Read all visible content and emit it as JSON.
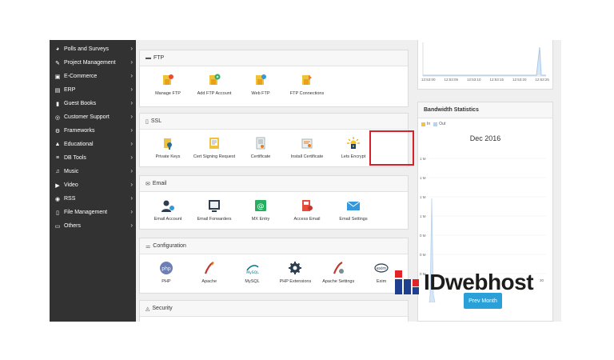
{
  "sidebar": {
    "items": [
      {
        "label": "Polls and Surveys",
        "icon": "pie-chart-icon",
        "glyph": "◕"
      },
      {
        "label": "Project Management",
        "icon": "edit-icon",
        "glyph": "✎"
      },
      {
        "label": "E-Commerce",
        "icon": "cart-icon",
        "glyph": "🛒"
      },
      {
        "label": "ERP",
        "icon": "chart-icon",
        "glyph": "▤"
      },
      {
        "label": "Guest Books",
        "icon": "book-icon",
        "glyph": "▮"
      },
      {
        "label": "Customer Support",
        "icon": "support-icon",
        "glyph": "◎"
      },
      {
        "label": "Frameworks",
        "icon": "cogs-icon",
        "glyph": "⚙"
      },
      {
        "label": "Educational",
        "icon": "graduation-cap-icon",
        "glyph": "🎓"
      },
      {
        "label": "DB Tools",
        "icon": "database-icon",
        "glyph": "≡"
      },
      {
        "label": "Music",
        "icon": "music-icon",
        "glyph": "♫"
      },
      {
        "label": "Video",
        "icon": "video-icon",
        "glyph": "▶"
      },
      {
        "label": "RSS",
        "icon": "rss-icon",
        "glyph": "◉"
      },
      {
        "label": "File Management",
        "icon": "file-icon",
        "glyph": "▯"
      },
      {
        "label": "Others",
        "icon": "folder-icon",
        "glyph": "▭"
      }
    ]
  },
  "panels": {
    "ftp": {
      "title": "FTP",
      "tools": [
        {
          "label": "Manage FTP",
          "icon": "manage-ftp-icon"
        },
        {
          "label": "Add FTP Account",
          "icon": "add-ftp-icon"
        },
        {
          "label": "Web FTP",
          "icon": "web-ftp-icon"
        },
        {
          "label": "FTP Connections",
          "icon": "ftp-connections-icon"
        }
      ]
    },
    "ssl": {
      "title": "SSL",
      "tools": [
        {
          "label": "Private Keys",
          "icon": "private-keys-icon"
        },
        {
          "label": "Cert Signing Request",
          "icon": "cert-signing-icon"
        },
        {
          "label": "Certificate",
          "icon": "certificate-icon"
        },
        {
          "label": "Install Certificate",
          "icon": "install-certificate-icon"
        },
        {
          "label": "Lets Encrypt",
          "icon": "lets-encrypt-icon"
        }
      ]
    },
    "email": {
      "title": "Email",
      "tools": [
        {
          "label": "Email Account",
          "icon": "email-account-icon"
        },
        {
          "label": "Email Forwarders",
          "icon": "email-forwarders-icon"
        },
        {
          "label": "MX Entry",
          "icon": "mx-entry-icon"
        },
        {
          "label": "Access Email",
          "icon": "access-email-icon"
        },
        {
          "label": "Email Settings",
          "icon": "email-settings-icon"
        }
      ]
    },
    "configuration": {
      "title": "Configuration",
      "tools": [
        {
          "label": "PHP",
          "icon": "php-icon"
        },
        {
          "label": "Apache",
          "icon": "apache-icon"
        },
        {
          "label": "MySQL",
          "icon": "mysql-icon"
        },
        {
          "label": "PHP Extensions",
          "icon": "php-extensions-icon"
        },
        {
          "label": "Apache Settings",
          "icon": "apache-settings-icon"
        },
        {
          "label": "Exim",
          "icon": "exim-icon"
        }
      ]
    },
    "security": {
      "title": "Security"
    }
  },
  "top_chart": {
    "time_labels": [
      "12:53:00",
      "12:53:05",
      "12:53:10",
      "12:53:15",
      "12:53:20",
      "12:53:25"
    ]
  },
  "bandwidth": {
    "title": "Bandwidth Statistics",
    "legend_in": "In",
    "legend_out": "Out",
    "month": "Dec 2016",
    "y_labels": [
      "1 M",
      "1 M",
      "1 M",
      "1 M",
      "0 M",
      "0 M",
      "0 M"
    ],
    "x_tail": "30",
    "prev_month": "Prev Month",
    "in_color": "#f5c242",
    "out_color": "#b8d3ee"
  },
  "brand": {
    "name": "IDwebhost"
  },
  "colors": {
    "sidebar_bg": "#323232",
    "highlight": "#d6202a",
    "accent": "#2aa0d8"
  }
}
